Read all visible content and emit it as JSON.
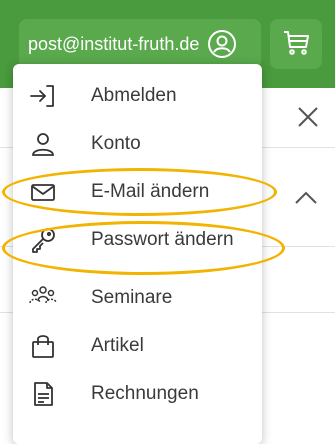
{
  "header": {
    "account_email": "post@institut-fruth.de",
    "user_icon": "user-circle-icon",
    "cart_icon": "shopping-cart-icon"
  },
  "account_menu": {
    "items": [
      {
        "label": "Abmelden",
        "icon": "logout-icon"
      },
      {
        "label": "Konto",
        "icon": "user-icon"
      },
      {
        "label": "E-Mail ändern",
        "icon": "envelope-icon"
      },
      {
        "label": "Passwort ändern",
        "icon": "key-icon"
      },
      {
        "label": "Seminare",
        "icon": "group-icon"
      },
      {
        "label": "Artikel",
        "icon": "shopping-bag-icon"
      },
      {
        "label": "Rechnungen",
        "icon": "invoice-icon"
      }
    ]
  },
  "colors": {
    "header_green": "#4a9a3e",
    "button_green": "#5aa94d",
    "highlight": "#f2b400"
  }
}
